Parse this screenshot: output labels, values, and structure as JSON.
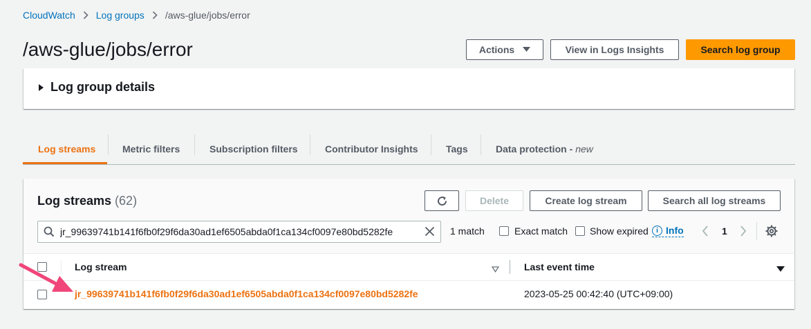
{
  "breadcrumb": {
    "items": [
      "CloudWatch",
      "Log groups"
    ],
    "current": "/aws-glue/jobs/error"
  },
  "page": {
    "title": "/aws-glue/jobs/error"
  },
  "header_actions": {
    "actions_label": "Actions",
    "insights_label": "View in Logs Insights",
    "search_label": "Search log group"
  },
  "details": {
    "label": "Log group details",
    "expanded": false
  },
  "tabs": [
    {
      "label": "Log streams",
      "active": true
    },
    {
      "label": "Metric filters"
    },
    {
      "label": "Subscription filters"
    },
    {
      "label": "Contributor Insights"
    },
    {
      "label": "Tags"
    },
    {
      "label": "Data protection -",
      "suffix": "new"
    }
  ],
  "streams": {
    "title": "Log streams",
    "count": "(62)",
    "delete_label": "Delete",
    "create_label": "Create log stream",
    "search_all_label": "Search all log streams",
    "search_value": "jr_99639741b141f6fb0f29f6da30ad1ef6505abda0f1ca134cf0097e80bd5282fe",
    "match_text": "1 match",
    "exact_match_label": "Exact match",
    "show_expired_label": "Show expired",
    "info_label": "Info",
    "page_number": "1",
    "columns": [
      "Log stream",
      "Last event time"
    ],
    "rows": [
      {
        "stream": "jr_99639741b141f6fb0f29f6da30ad1ef6505abda0f1ca134cf0097e80bd5282fe",
        "last_event": "2023-05-25 00:42:40 (UTC+09:00)"
      }
    ]
  },
  "colors": {
    "accent": "#ec7211",
    "primary_button": "#ff9900",
    "link": "#0073bb",
    "annotation_arrow": "#f0467a"
  }
}
